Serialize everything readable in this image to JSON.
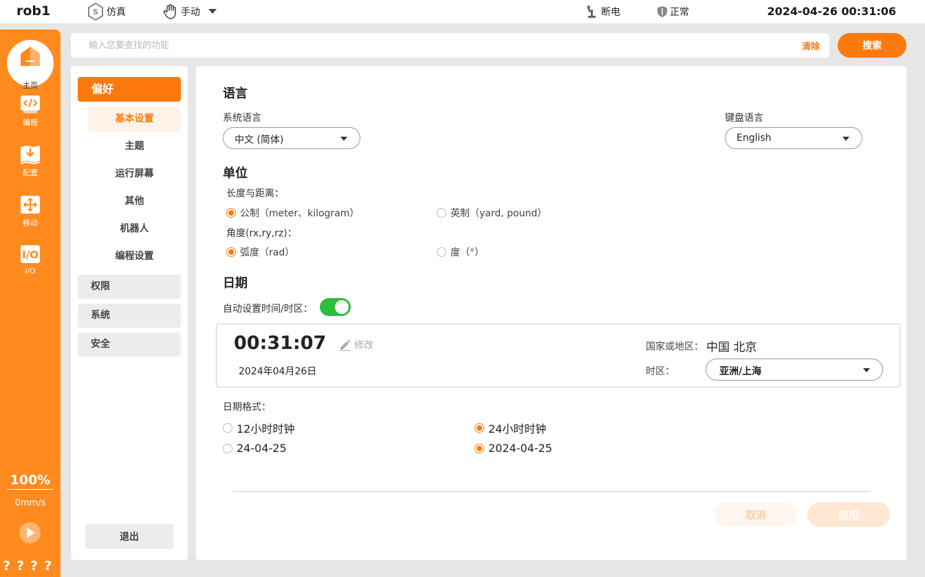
{
  "topbar": {
    "robot_name": "rob1",
    "sim_label": "仿真",
    "mode_label": "手动",
    "power_label": "断电",
    "status_label": "正常",
    "datetime": "2024-04-26 00:31:06"
  },
  "rail": {
    "home_label": "主页",
    "items": [
      {
        "label": "编程",
        "icon": "code-icon"
      },
      {
        "label": "配置",
        "icon": "download-config-icon"
      },
      {
        "label": "移动",
        "icon": "move-arrows-icon"
      },
      {
        "label": "I/O",
        "icon": "io-icon"
      }
    ],
    "speed_percent": "100%",
    "speed_value": "0mm/s",
    "help": "????"
  },
  "search": {
    "placeholder": "输入您要查找的功能",
    "clear_label": "清除",
    "button_label": "搜索"
  },
  "nav": {
    "group": "偏好",
    "subitems": [
      "基本设置",
      "主题",
      "运行屏幕",
      "其他",
      "机器人",
      "编程设置"
    ],
    "active": "基本设置",
    "sections": [
      "权限",
      "系统",
      "安全"
    ],
    "logout_label": "退出"
  },
  "main": {
    "language": {
      "title": "语言",
      "system_label": "系统语言",
      "system_value": "中文 (简体)",
      "keyboard_label": "键盘语言",
      "keyboard_value": "English"
    },
    "units": {
      "title": "单位",
      "length_label": "长度与距离：",
      "length_options": [
        "公制（meter、kilogram）",
        "英制（yard, pound）"
      ],
      "length_selected": 0,
      "angle_label": "角度(rx,ry,rz)：",
      "angle_options": [
        "弧度（rad）",
        "度（°）"
      ],
      "angle_selected": 0
    },
    "date": {
      "title": "日期",
      "auto_label": "自动设置时间/时区：",
      "auto_on": true,
      "time": "00:31:07",
      "edit_label": "修改",
      "date": "2024年04月26日",
      "country_label": "国家或地区：",
      "country_value": "中国 北京",
      "timezone_label": "时区：",
      "timezone_value": "亚洲/上海",
      "format_label": "日期格式：",
      "clock_options": [
        "12小时时钟",
        "24小时时钟"
      ],
      "clock_selected": 1,
      "date_options": [
        "24-04-25",
        "2024-04-25"
      ],
      "date_selected": 1
    },
    "cancel_label": "取消",
    "apply_label": "应用"
  },
  "colors": {
    "accent": "#ff7a0d",
    "rail": "#ff8a1e",
    "toggle_on": "#2dbd3a"
  }
}
